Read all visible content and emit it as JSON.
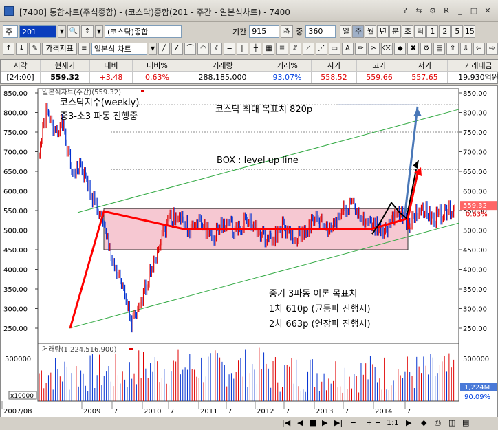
{
  "window": {
    "title": "[7400] 통합차트(주식종합) - (코스닥)종합(201 - 주간 - 일본식차트) - 7400"
  },
  "toolbar1": {
    "market": "주",
    "code": "201",
    "name": "(코스닥)종합",
    "period_label": "기간",
    "period_value": "915",
    "count_label": "중",
    "count_value": "360",
    "timeframes": [
      "일",
      "주",
      "월",
      "년",
      "분",
      "초",
      "틱",
      "1",
      "2",
      "5",
      "15"
    ],
    "active_timeframe": "주"
  },
  "toolbar2": {
    "indicator_label": "가격지표",
    "chart_type": "일본식 차트"
  },
  "quote": {
    "headers": [
      "시각",
      "현재가",
      "대비",
      "대비%",
      "거래량",
      "거래%",
      "시가",
      "고가",
      "저가",
      "거래대금"
    ],
    "values": [
      "[24:00]",
      "559.32",
      "+3.48",
      "0.63%",
      "288,185,000",
      "93.07%",
      "558.52",
      "559.66",
      "557.65",
      "19,930억원"
    ]
  },
  "chart": {
    "price_legend": "일본식차트(주간)(559.32)",
    "volume_legend": "거래량(1,224,516,900)",
    "price_ticks": [
      "850.00",
      "800.00",
      "750.00",
      "700.00",
      "650.00",
      "600.00",
      "550.00",
      "500.00",
      "450.00",
      "400.00",
      "350.00",
      "300.00",
      "250.00"
    ],
    "volume_tick": "500000",
    "volume_unit": "x10000",
    "last_price_tag": "559.32",
    "last_change_tag": "0.63%",
    "last_volume_tag": "1,224M",
    "last_volume_pct": "90.09%",
    "x_labels": [
      "2007/08",
      "2009",
      "7",
      "2010",
      "7",
      "2011",
      "7",
      "2012",
      "7",
      "2013",
      "7",
      "2014",
      "7"
    ],
    "annotations": {
      "title1": "코스닥지수(weekly)",
      "title2": "중3-소3 파동 진행중",
      "target_max": "코스닥 최대 목표치 820p",
      "box": "BOX : level up line",
      "target_head": "중기 3파동 이론 목표치",
      "target1": "1차 610p (균등파 진행시)",
      "target2": "2차 663p (연장파 진행시)"
    }
  },
  "colors": {
    "up": "#e00000",
    "down": "#0030d0",
    "box_fill": "#f6c8d2",
    "channel": "#33aa44",
    "trend": "#ff0000",
    "target_arrow": "#4a78b8"
  },
  "bottom": {
    "zoom": "1:1"
  }
}
